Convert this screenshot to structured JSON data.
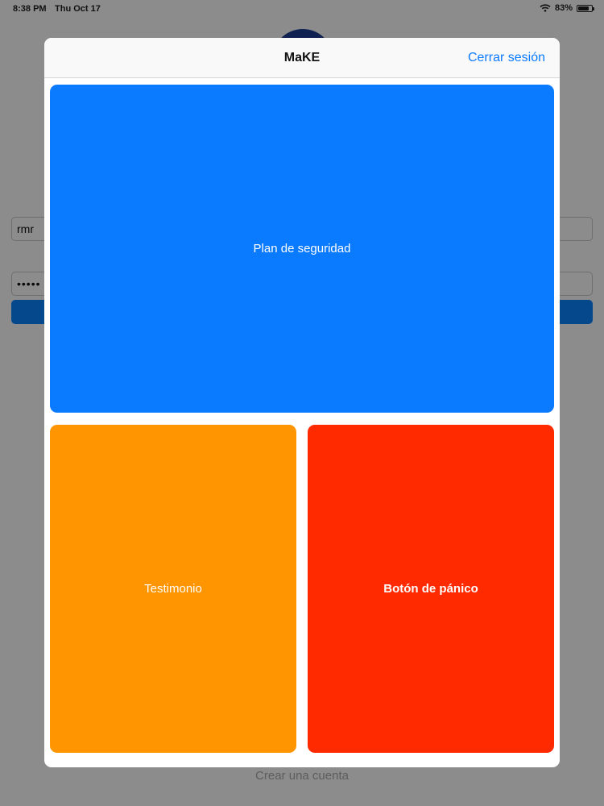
{
  "status_bar": {
    "time": "8:38 PM",
    "date": "Thu Oct 17",
    "battery_text": "83%",
    "battery_level": 0.83
  },
  "background": {
    "username_value": "rmr",
    "password_value": "•••••",
    "create_account_label": "Crear una cuenta",
    "login_button_color": "#0a84ff",
    "logo_color": "#1c3f94"
  },
  "modal": {
    "title": "MaKE",
    "signout_label": "Cerrar sesión"
  },
  "tiles": {
    "plan": {
      "label": "Plan de seguridad",
      "color": "#0a7aff"
    },
    "testimonio": {
      "label": "Testimonio",
      "color": "#ff9500"
    },
    "panico": {
      "label": "Botón de pánico",
      "color": "#ff2a00"
    }
  }
}
